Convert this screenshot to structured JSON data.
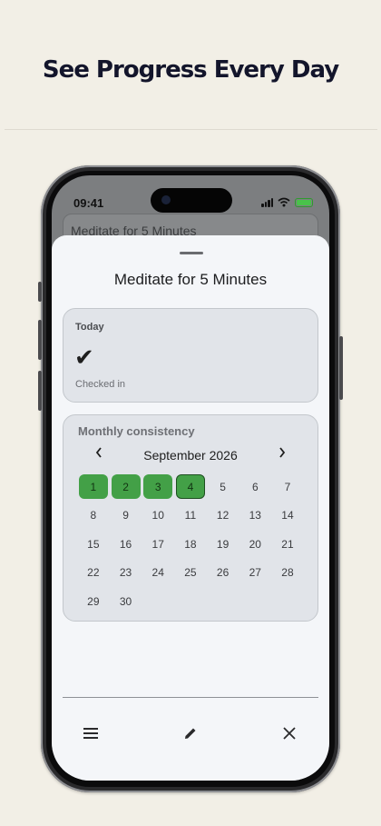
{
  "headline": "See Progress Every Day",
  "status_bar": {
    "time": "09:41",
    "icons": [
      "signal-icon",
      "wifi-icon",
      "battery-icon"
    ]
  },
  "background_card_title": "Meditate for 5 Minutes",
  "sheet": {
    "title": "Meditate for 5 Minutes",
    "today": {
      "label": "Today",
      "status_icon": "checkmark-icon",
      "status_text": "Checked in"
    },
    "monthly": {
      "label": "Monthly consistency",
      "month": "September 2026",
      "prev_icon": "chevron-left-icon",
      "next_icon": "chevron-right-icon",
      "leading_blank_days": 0,
      "days": [
        "1",
        "2",
        "3",
        "4",
        "5",
        "6",
        "7",
        "8",
        "9",
        "10",
        "11",
        "12",
        "13",
        "14",
        "15",
        "16",
        "17",
        "18",
        "19",
        "20",
        "21",
        "22",
        "23",
        "24",
        "25",
        "26",
        "27",
        "28",
        "29",
        "30"
      ],
      "checked_days": [
        1,
        2,
        3,
        4
      ],
      "today": 4
    },
    "bottom_bar": {
      "icons": [
        "menu-icon",
        "edit-icon",
        "close-icon"
      ]
    }
  },
  "colors": {
    "checked": "#43a047",
    "background": "#f2efe6",
    "sheet": "#f4f6f9",
    "card": "#e1e4e9"
  }
}
